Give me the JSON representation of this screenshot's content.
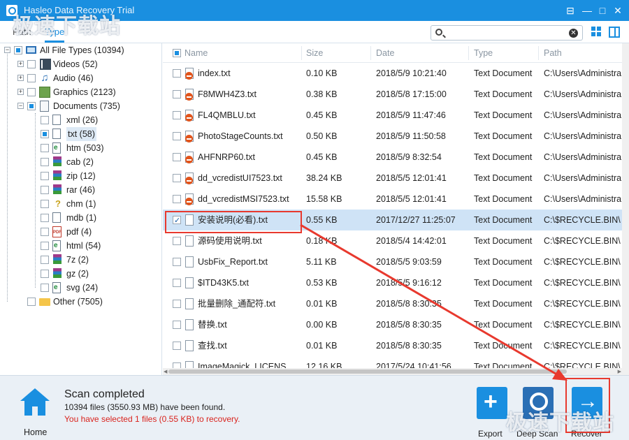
{
  "window": {
    "title": "Hasleo Data Recovery Trial",
    "controls": [
      "⊟",
      "—",
      "□",
      "✕"
    ]
  },
  "toolbar": {
    "tabs": [
      {
        "label": "Path",
        "active": false
      },
      {
        "label": "Type",
        "active": true
      }
    ],
    "search": {
      "value": "",
      "placeholder": ""
    },
    "accent": "#1a8fe0"
  },
  "tree": {
    "root": {
      "label": "All File Types (10394)",
      "state": "partial"
    },
    "groups": [
      {
        "label": "Videos (52)",
        "icon": "video-icon",
        "state": "unchecked"
      },
      {
        "label": "Audio (46)",
        "icon": "music-note-icon",
        "state": "unchecked"
      },
      {
        "label": "Graphics (2123)",
        "icon": "image-icon",
        "state": "unchecked"
      },
      {
        "label": "Documents (735)",
        "icon": "document-icon",
        "state": "partial"
      }
    ],
    "documents": [
      {
        "label": "xml (26)",
        "icon": "xml-file-icon",
        "state": "unchecked"
      },
      {
        "label": "txt (58)",
        "icon": "text-file-icon",
        "state": "partial"
      },
      {
        "label": "htm (503)",
        "icon": "htm-file-icon",
        "state": "unchecked"
      },
      {
        "label": "cab (2)",
        "icon": "winrar-icon",
        "state": "unchecked"
      },
      {
        "label": "zip (12)",
        "icon": "winrar-icon",
        "state": "unchecked"
      },
      {
        "label": "rar (46)",
        "icon": "winrar-icon",
        "state": "unchecked"
      },
      {
        "label": "chm (1)",
        "icon": "help-file-icon",
        "state": "unchecked"
      },
      {
        "label": "mdb (1)",
        "icon": "file-icon",
        "state": "unchecked"
      },
      {
        "label": "pdf (4)",
        "icon": "pdf-icon",
        "state": "unchecked"
      },
      {
        "label": "html (54)",
        "icon": "html-file-icon",
        "state": "unchecked"
      },
      {
        "label": "7z (2)",
        "icon": "winrar-icon",
        "state": "unchecked"
      },
      {
        "label": "gz (2)",
        "icon": "winrar-icon",
        "state": "unchecked"
      },
      {
        "label": "svg (24)",
        "icon": "svg-file-icon",
        "state": "unchecked"
      }
    ],
    "other": {
      "label": "Other (7505)",
      "icon": "folder-icon",
      "state": "unchecked"
    }
  },
  "table": {
    "columns": [
      "Name",
      "Size",
      "Date",
      "Type",
      "Path"
    ],
    "rows": [
      {
        "name": "index.txt",
        "size": "0.10 KB",
        "date": "2018/5/9 10:21:40",
        "type": "Text Document",
        "path": "C:\\Users\\Administra",
        "deleted": true,
        "selected": false
      },
      {
        "name": "F8MWH4Z3.txt",
        "size": "0.38 KB",
        "date": "2018/5/8 17:15:00",
        "type": "Text Document",
        "path": "C:\\Users\\Administra",
        "deleted": true,
        "selected": false
      },
      {
        "name": "FL4QMBLU.txt",
        "size": "0.45 KB",
        "date": "2018/5/9 11:47:46",
        "type": "Text Document",
        "path": "C:\\Users\\Administra",
        "deleted": true,
        "selected": false
      },
      {
        "name": "PhotoStageCounts.txt",
        "size": "0.50 KB",
        "date": "2018/5/9 11:50:58",
        "type": "Text Document",
        "path": "C:\\Users\\Administra",
        "deleted": true,
        "selected": false
      },
      {
        "name": "AHFNRP60.txt",
        "size": "0.45 KB",
        "date": "2018/5/9 8:32:54",
        "type": "Text Document",
        "path": "C:\\Users\\Administra",
        "deleted": true,
        "selected": false
      },
      {
        "name": "dd_vcredistUI7523.txt",
        "size": "38.24 KB",
        "date": "2018/5/5 12:01:41",
        "type": "Text Document",
        "path": "C:\\Users\\Administra",
        "deleted": true,
        "selected": false
      },
      {
        "name": "dd_vcredistMSI7523.txt",
        "size": "15.58 KB",
        "date": "2018/5/5 12:01:41",
        "type": "Text Document",
        "path": "C:\\Users\\Administra",
        "deleted": true,
        "selected": false
      },
      {
        "name": "安装说明(必看).txt",
        "size": "0.55 KB",
        "date": "2017/12/27 11:25:07",
        "type": "Text Document",
        "path": "C:\\$RECYCLE.BIN\\",
        "deleted": false,
        "selected": true
      },
      {
        "name": "源码使用说明.txt",
        "size": "0.18 KB",
        "date": "2018/5/4 14:42:01",
        "type": "Text Document",
        "path": "C:\\$RECYCLE.BIN\\",
        "deleted": false,
        "selected": false
      },
      {
        "name": "UsbFix_Report.txt",
        "size": "5.11 KB",
        "date": "2018/5/5 9:03:59",
        "type": "Text Document",
        "path": "C:\\$RECYCLE.BIN\\",
        "deleted": false,
        "selected": false
      },
      {
        "name": "$ITD43K5.txt",
        "size": "0.53 KB",
        "date": "2018/5/5 9:16:12",
        "type": "Text Document",
        "path": "C:\\$RECYCLE.BIN\\",
        "deleted": false,
        "selected": false
      },
      {
        "name": "批量删除_通配符.txt",
        "size": "0.01 KB",
        "date": "2018/5/8 8:30:35",
        "type": "Text Document",
        "path": "C:\\$RECYCLE.BIN\\",
        "deleted": false,
        "selected": false
      },
      {
        "name": "替换.txt",
        "size": "0.00 KB",
        "date": "2018/5/8 8:30:35",
        "type": "Text Document",
        "path": "C:\\$RECYCLE.BIN\\",
        "deleted": false,
        "selected": false
      },
      {
        "name": "查找.txt",
        "size": "0.01 KB",
        "date": "2018/5/8 8:30:35",
        "type": "Text Document",
        "path": "C:\\$RECYCLE.BIN\\",
        "deleted": false,
        "selected": false
      },
      {
        "name": "ImageMagick_LICENS",
        "size": "12.16 KB",
        "date": "2017/5/24 10:41:56",
        "type": "Text Document",
        "path": "C:\\$RECYCLE.BIN\\",
        "deleted": false,
        "selected": false
      }
    ]
  },
  "status": {
    "title": "Scan completed",
    "summary": "10394 files (3550.93 MB) have been found.",
    "selection": "You have selected 1 files (0.55 KB) to recovery.",
    "selection_color": "#d9231d"
  },
  "actions": {
    "home": "Home",
    "export": "Export",
    "deep_scan": "Deep Scan",
    "recover": "Recover"
  },
  "watermark": {
    "text": "极速下载站"
  },
  "annotation_color": "#e8392e"
}
